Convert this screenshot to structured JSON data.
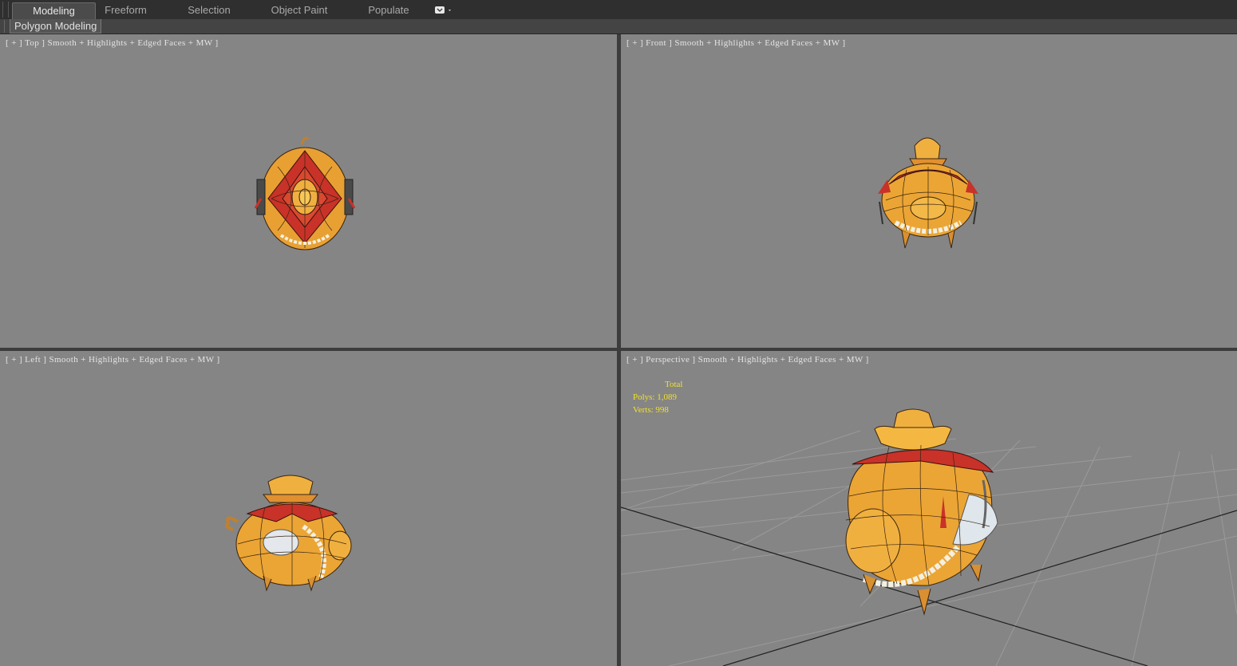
{
  "ribbon": {
    "tabs": [
      {
        "label": "Modeling",
        "active": true
      },
      {
        "label": "Freeform",
        "active": false
      },
      {
        "label": "Selection",
        "active": false
      },
      {
        "label": "Object Paint",
        "active": false
      },
      {
        "label": "Populate",
        "active": false
      }
    ],
    "panel_label": "Polygon Modeling"
  },
  "viewports": {
    "top": {
      "label": "[ + ] Top ] Smooth + Highlights + Edged Faces + MW ]"
    },
    "front": {
      "label": "[ + ] Front ] Smooth + Highlights + Edged Faces + MW ]"
    },
    "left": {
      "label": "[ + ] Left ] Smooth + Highlights + Edged Faces + MW ]"
    },
    "perspective": {
      "label": "[ + ] Perspective ] Smooth + Highlights + Edged Faces + MW ]",
      "stats": {
        "header": "Total",
        "polys": "Polys: 1,089",
        "verts": "Verts: 998"
      }
    }
  },
  "colors": {
    "viewport_bg": "#858585",
    "model_gold": "#f0a830",
    "model_red": "#c83228",
    "stats_text": "#f2e12b"
  },
  "icons": [
    "chevron-down-icon"
  ]
}
